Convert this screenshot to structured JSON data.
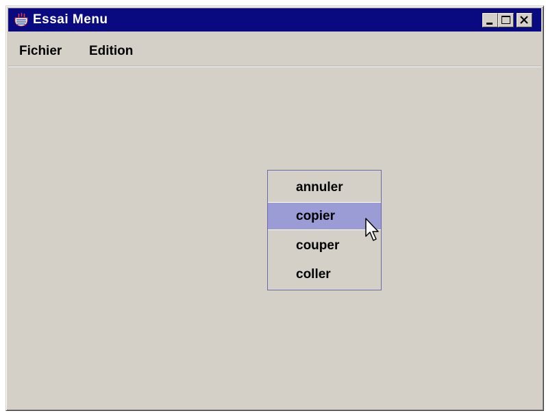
{
  "window": {
    "title": "Essai Menu",
    "buttons": {
      "minimize": "minimize-icon",
      "maximize": "maximize-icon",
      "close": "close-icon"
    }
  },
  "menubar": {
    "items": [
      {
        "label": "Fichier"
      },
      {
        "label": "Edition"
      }
    ]
  },
  "popup_menu": {
    "items": [
      {
        "label": "annuler",
        "selected": false
      },
      {
        "label": "copier",
        "selected": true
      },
      {
        "label": "couper",
        "selected": false
      },
      {
        "label": "coller",
        "selected": false
      }
    ]
  },
  "colors": {
    "titlebar": "#0a0a80",
    "background": "#d4d0c8",
    "selection": "#9b9bd6",
    "popup_border": "#6a6aa8"
  }
}
